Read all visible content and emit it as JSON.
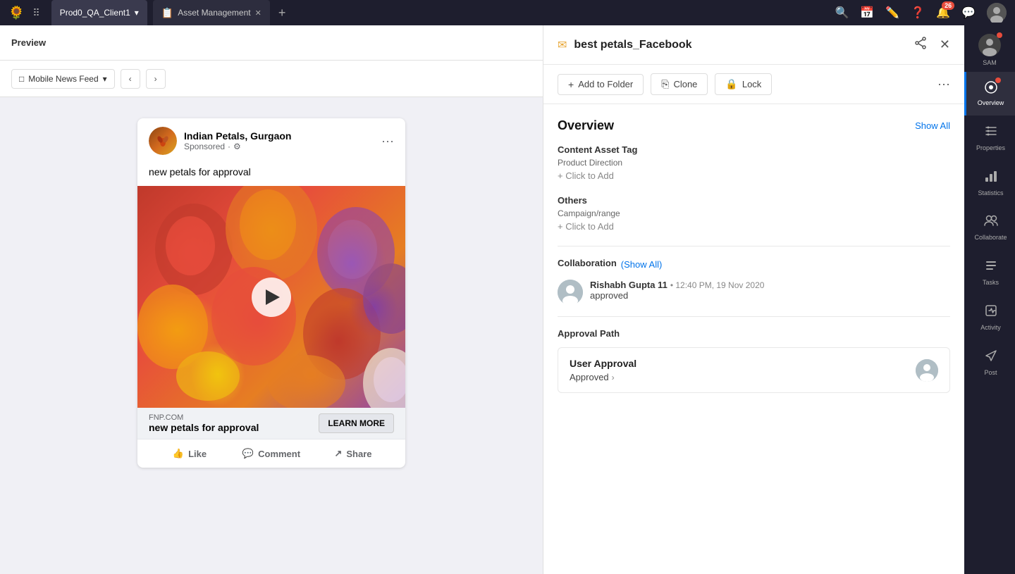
{
  "topbar": {
    "logo": "🌻",
    "workspace": "Prod0_QA_Client1",
    "tab_icon": "📋",
    "tab_label": "Asset Management",
    "add_tab": "+",
    "icons": {
      "search": "🔍",
      "calendar": "📅",
      "edit": "✏️",
      "help": "❓",
      "notification_count": "26",
      "chat": "💬"
    }
  },
  "preview": {
    "title": "Preview",
    "dropdown_label": "Mobile News Feed",
    "dropdown_icon": "□",
    "nav_prev": "‹",
    "nav_next": "›"
  },
  "facebook_card": {
    "page_name": "Indian Petals, Gurgaon",
    "sponsored": "Sponsored",
    "post_text": "new petals for approval",
    "domain": "FNP.COM",
    "cta_text": "new petals for approval",
    "cta_button": "LEARN MORE",
    "like": "Like",
    "comment": "Comment",
    "share": "Share"
  },
  "detail": {
    "header_icon": "✉",
    "title": "best petals_Facebook",
    "add_to_folder": "Add to Folder",
    "clone": "Clone",
    "lock": "Lock",
    "overview_section": "Overview",
    "show_all": "Show All",
    "content_asset_tag": "Content Asset Tag",
    "product_direction": "Product Direction",
    "click_to_add_1": "+ Click to Add",
    "others": "Others",
    "campaign_range": "Campaign/range",
    "click_to_add_2": "+ Click to Add",
    "collaboration": "Collaboration",
    "show_all_collab": "(Show All)",
    "collaborator_name": "Rishabh Gupta 11",
    "collaborator_meta": "• 12:40 PM, 19 Nov 2020",
    "collaborator_status": "approved",
    "approval_path": "Approval Path",
    "user_approval": "User Approval",
    "approved": "Approved"
  },
  "right_sidebar": {
    "sam_label": "SAM",
    "items": [
      {
        "id": "overview",
        "icon": "⊙",
        "label": "Overview",
        "active": true
      },
      {
        "id": "properties",
        "icon": "🏷",
        "label": "Properties"
      },
      {
        "id": "statistics",
        "icon": "📊",
        "label": "Statistics"
      },
      {
        "id": "collaborate",
        "icon": "👥",
        "label": "Collaborate"
      },
      {
        "id": "tasks",
        "icon": "☰",
        "label": "Tasks"
      },
      {
        "id": "activity",
        "icon": "⊟",
        "label": "Activity"
      },
      {
        "id": "post",
        "icon": "➤",
        "label": "Post"
      }
    ]
  }
}
